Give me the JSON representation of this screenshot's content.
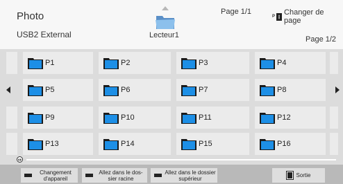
{
  "header": {
    "title": "Photo",
    "device": "USB2 External",
    "drive_label": "Lecteur1",
    "page_center": "Page 1/1",
    "change_page_label": "Changer de page",
    "change_page_key": "P",
    "page_right": "Page 1/2"
  },
  "folders": [
    "P1",
    "P2",
    "P3",
    "P4",
    "P5",
    "P6",
    "P7",
    "P8",
    "P9",
    "P10",
    "P11",
    "P12",
    "P13",
    "P14",
    "P15",
    "P16"
  ],
  "footer": {
    "change_device": "Changement d'appareil",
    "root_folder": "Allez dans le dos-sier racine",
    "parent_folder": "Allez dans le dossier supérieur",
    "exit": "Sortie"
  },
  "colors": {
    "folder_blue": "#1d8fe6",
    "folder_dark": "#1a1a1a",
    "tile_bg": "#ebebeb",
    "grid_bg": "#dcdcdc",
    "footer_bg": "#b9b9b9"
  }
}
